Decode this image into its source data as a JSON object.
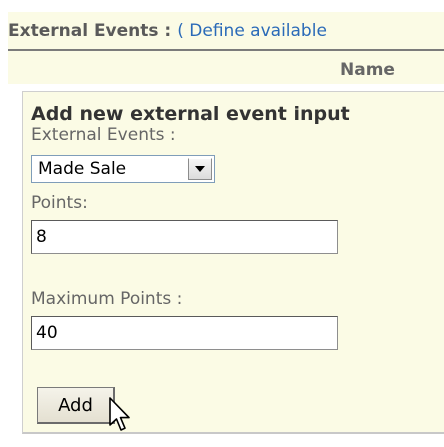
{
  "header": {
    "section_title": "External Events :",
    "open_paren": "(",
    "define_link": "Define available",
    "column_name": "Name"
  },
  "panel": {
    "title": "Add new external event input",
    "external_events_label": "External Events :",
    "external_events_selected": "Made Sale",
    "points_label": "Points:",
    "points_value": "8",
    "max_points_label": "Maximum Points :",
    "max_points_value": "40",
    "add_button_label": "Add"
  },
  "icons": {
    "dropdown_arrow": "chevron-down-icon",
    "mouse_pointer": "cursor-arrow-icon"
  },
  "colors": {
    "panel_background": "#fbfbe5",
    "link": "#2a6ab8"
  }
}
